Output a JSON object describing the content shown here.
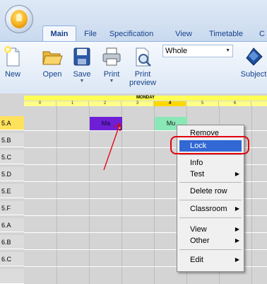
{
  "ribbon": {
    "tabs": [
      {
        "label": "Main",
        "active": true
      },
      {
        "label": "File",
        "active": false
      },
      {
        "label": "Specification",
        "active": false
      },
      {
        "label": "View",
        "active": false
      },
      {
        "label": "Timetable",
        "active": false
      },
      {
        "label": "C",
        "active": false
      }
    ],
    "buttons": {
      "new": "New",
      "open": "Open",
      "save": "Save",
      "print": "Print",
      "print_preview": "Print\npreview",
      "subject": "Subject"
    },
    "view_combo": {
      "value": "Whole"
    }
  },
  "timetable": {
    "day": "MONDAY",
    "periods": [
      "0",
      "1",
      "2",
      "3",
      "4",
      "5",
      "6"
    ],
    "current_period": "4",
    "rows": [
      "5.A",
      "5.B",
      "5.C",
      "5.D",
      "5.E",
      "5.F",
      "6.A",
      "6.B",
      "6.C"
    ],
    "selected_row": "5.A",
    "lessons": [
      {
        "row": "5.A",
        "period": "2",
        "text": "Ma",
        "color": "#6e1fd6"
      },
      {
        "row": "5.A",
        "period": "4",
        "text": "Mu",
        "color": "#8ae8b6"
      }
    ]
  },
  "context_menu": {
    "items": [
      {
        "label": "Remove",
        "submenu": false
      },
      {
        "label": "Lock",
        "submenu": false,
        "highlighted": true
      },
      {
        "label": "Info",
        "submenu": false
      },
      {
        "label": "Test",
        "submenu": true
      },
      {
        "label": "Delete row",
        "submenu": false
      },
      {
        "label": "Classroom",
        "submenu": true
      },
      {
        "label": "View",
        "submenu": true
      },
      {
        "label": "Other",
        "submenu": true
      },
      {
        "label": "Edit",
        "submenu": true
      }
    ]
  },
  "colors": {
    "highlight": "#3168d3",
    "annotation": "#e3000f",
    "day_header": "#ffff55",
    "selected_row": "#ffe25c"
  }
}
